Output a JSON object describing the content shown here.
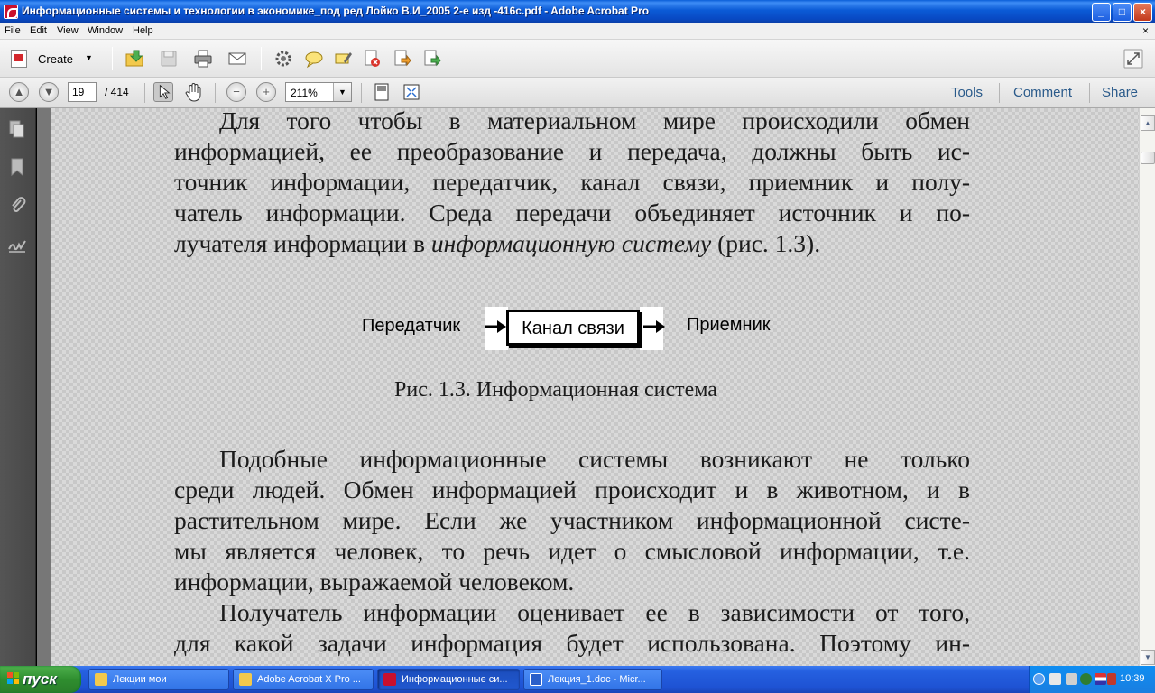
{
  "window": {
    "title": "Информационные системы и технологии в экономике_под ред Лойко В.И_2005 2-е изд -416с.pdf - Adobe Acrobat Pro",
    "buttons": {
      "minimize": "_",
      "maximize": "□",
      "close": "×"
    }
  },
  "menu": {
    "items": [
      "File",
      "Edit",
      "View",
      "Window",
      "Help"
    ],
    "close": "×"
  },
  "toolbar": {
    "create_label": "Create"
  },
  "nav": {
    "page_current": "19",
    "page_total": "/  414",
    "zoom": "211%",
    "links": {
      "tools": "Tools",
      "comment": "Comment",
      "share": "Share"
    }
  },
  "document": {
    "para1": [
      "Для того чтобы в материальном мире происходили обмен",
      "информацией, ее преобразование и передача, должны быть ис-",
      "точник информации, передатчик, канал связи, приемник и полу-",
      "чатель информации. Среда передачи объединяет источник и по-"
    ],
    "para1_last_start": "лучателя информации в ",
    "para1_last_italic": "информационную систему",
    "para1_last_end": " (рис. 1.3).",
    "diagram": {
      "sender": "Передатчик",
      "channel": "Канал связи",
      "receiver": "Приемник"
    },
    "caption": "Рис. 1.3. Информационная система",
    "para2": [
      "Подобные информационные системы возникают не только",
      "среди людей. Обмен информацией происходит и в животном, и в",
      "растительном мире. Если же участником информационной систе-",
      "мы является человек, то речь идет о смысловой информации, т.е.",
      "информации, выражаемой человеком."
    ],
    "para3": [
      "Получатель информации оценивает ее в зависимости от того,",
      "для какой задачи информация будет использована. Поэтому ин-"
    ]
  },
  "taskbar": {
    "start": "пуск",
    "tasks": [
      "Лекции мои",
      "Adobe Acrobat X Pro ...",
      "Информационные си...",
      "Лекция_1.doc - Micr..."
    ],
    "clock": "10:39"
  },
  "colors": {
    "titlebar": "#0b5bd6",
    "taskbar": "#1e52d3",
    "start": "#2f8e2f",
    "link": "#2a5a8a"
  }
}
